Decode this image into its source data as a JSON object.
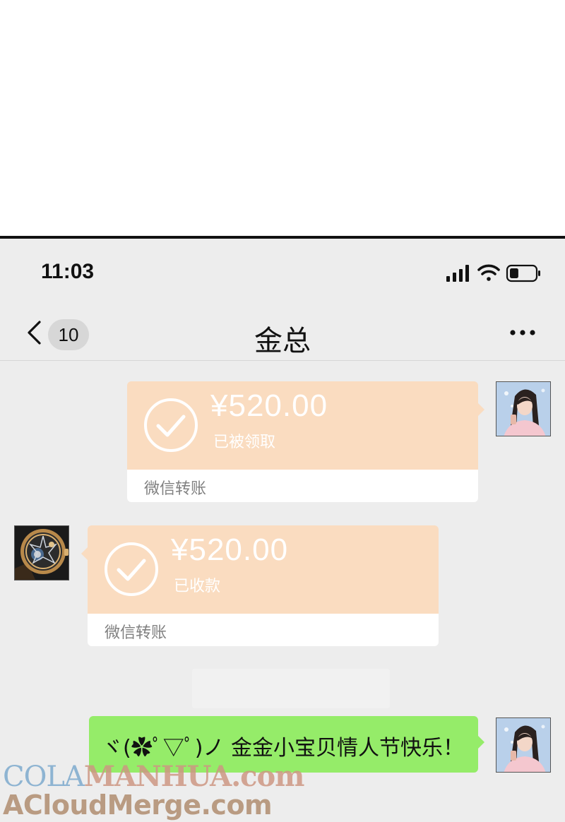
{
  "status_bar": {
    "time": "11:03",
    "icons": [
      "signal-icon",
      "wifi-icon",
      "battery-icon"
    ],
    "battery_level": 0.35
  },
  "nav": {
    "back_icon": "chevron-left-icon",
    "unread_count": "10",
    "title": "金总",
    "more_icon": "more-dots-icon"
  },
  "messages": [
    {
      "side": "right",
      "type": "transfer",
      "amount": "¥520.00",
      "status": "已被领取",
      "label": "微信转账",
      "sender_avatar": "woman-avatar"
    },
    {
      "side": "left",
      "type": "transfer",
      "amount": "¥520.00",
      "status": "已收款",
      "label": "微信转账",
      "sender_avatar": "watch-avatar"
    },
    {
      "side": "right",
      "type": "text",
      "text": "ヾ(✿ﾟ▽ﾟ)ノ 金金小宝贝情人节快乐！",
      "sender_avatar": "woman-avatar"
    }
  ],
  "watermarks": {
    "line1_part1": "COLA",
    "line1_part2": "MANHUA.com",
    "line2": "ACloudMerge.com"
  },
  "colors": {
    "chat_bg": "#ededed",
    "transfer_accent": "#fadcc0",
    "sent_bubble": "#95ec69"
  }
}
